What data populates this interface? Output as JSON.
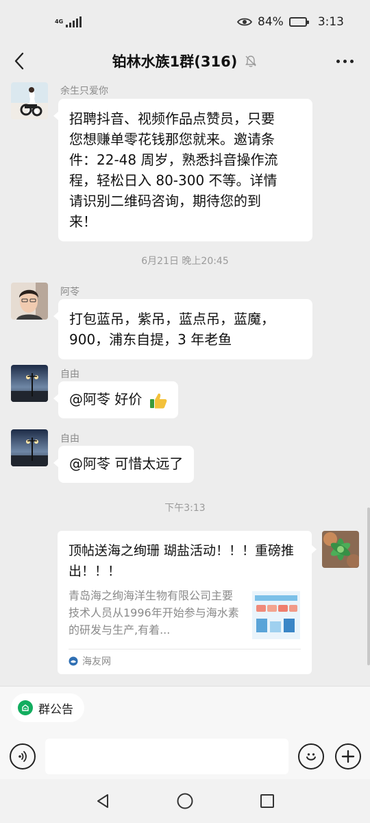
{
  "status_bar": {
    "network_label": "4G",
    "battery_text": "84%",
    "time": "3:13"
  },
  "header": {
    "title": "铂林水族1群(316)"
  },
  "messages": [
    {
      "sender": "余生只爱你",
      "text_lines": [
        "招聘抖音、视频作品点赞员，只要",
        "您想赚单零花钱那您就来。邀请条",
        "件：22-48 周岁，熟悉抖音操作流",
        "程，轻松日入 80-300 不等。详情",
        "请识别二维码咨询，期待您的到",
        "来！"
      ]
    },
    {
      "sender": "阿苓",
      "text_lines": [
        "打包蓝吊，紫吊，蓝点吊，蓝魔，",
        "900，浦东自提，3 年老鱼"
      ]
    },
    {
      "sender": "自由",
      "text": "@阿苓  好价"
    },
    {
      "sender": "自由",
      "text": "@阿苓  可惜太远了"
    }
  ],
  "timestamps": {
    "first": "6月21日 晚上20:45",
    "second": "下午3:13"
  },
  "link_card": {
    "title": "顶帖送海之绚珊 瑚盐活动！！！重磅推出！！！",
    "description": "青岛海之绚海洋生物有限公司主要技术人员从1996年开始参与海水素的研发与生产,有着...",
    "source": "海友网"
  },
  "input_bar": {
    "notice_label": "群公告"
  }
}
